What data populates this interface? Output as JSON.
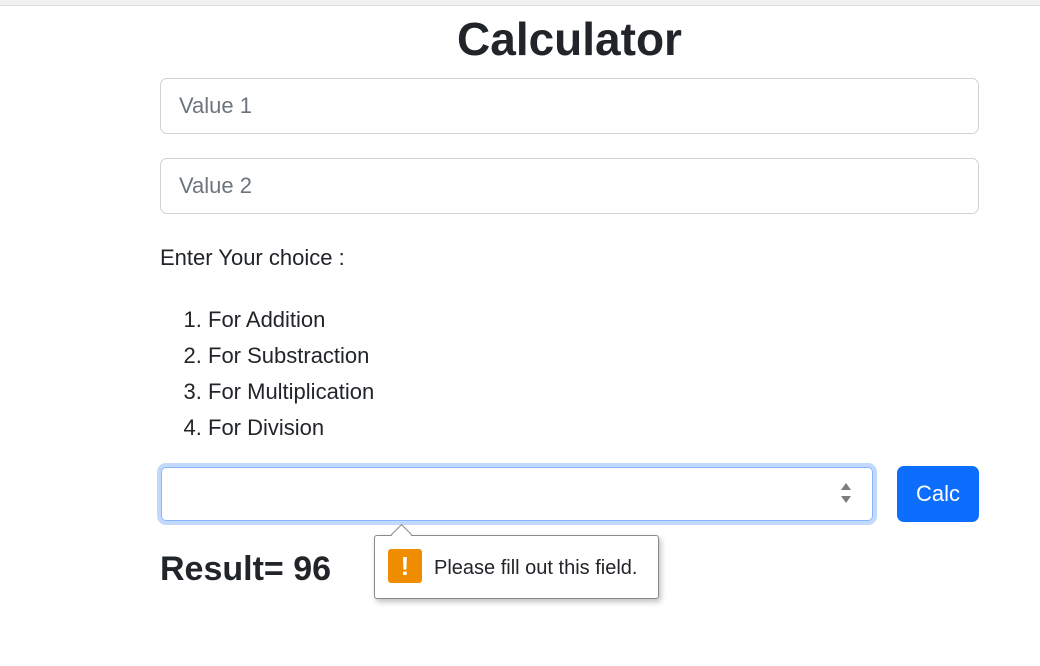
{
  "page": {
    "title": "Calculator"
  },
  "inputs": {
    "value1_placeholder": "Value 1",
    "value1_value": "",
    "value2_placeholder": "Value 2",
    "value2_value": ""
  },
  "choices": {
    "label": "Enter Your choice :",
    "options": [
      {
        "number": "1.",
        "label": "For Addition"
      },
      {
        "number": "2.",
        "label": "For Substraction"
      },
      {
        "number": "3.",
        "label": "For Multiplication"
      },
      {
        "number": "4.",
        "label": "For Division"
      }
    ],
    "choice_value": ""
  },
  "actions": {
    "calc_label": "Calc"
  },
  "result": {
    "text": "Result= 96"
  },
  "validation": {
    "message": "Please fill out this field.",
    "icon": "!",
    "icon_name": "warning-icon",
    "icon_color": "#f08c00"
  },
  "colors": {
    "primary": "#0d6efd",
    "focus_ring": "#c3d9fb"
  }
}
